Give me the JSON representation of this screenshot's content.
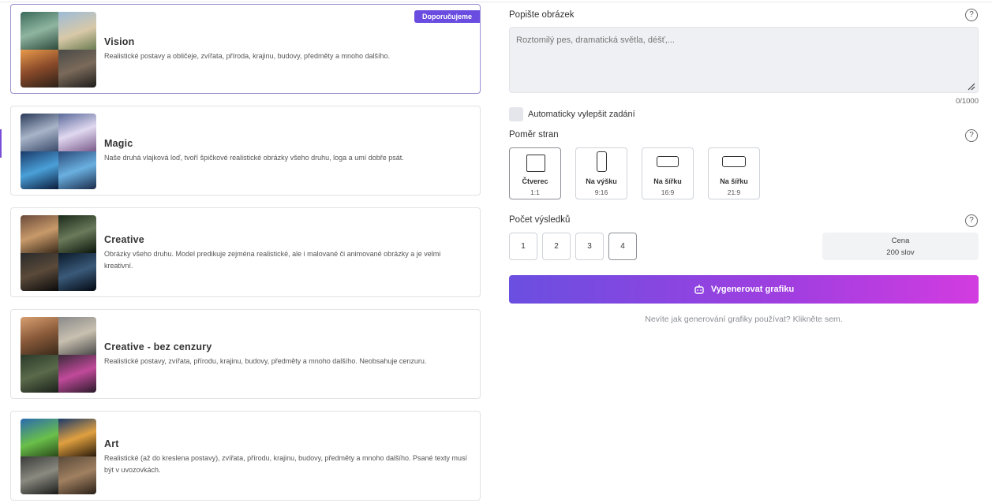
{
  "models": [
    {
      "title": "Vision",
      "description": "Realistické postavy a obličeje, zvířata, příroda, krajinu, budovy, předměty a mnoho dalšího.",
      "badge": "Doporučujeme",
      "selected": true
    },
    {
      "title": "Magic",
      "description": "Naše druhá vlajková loď, tvoří špičkové realistické obrázky všeho druhu, loga a umí dobře psát."
    },
    {
      "title": "Creative",
      "description": "Obrázky všeho druhu. Model predikuje zejména realistické, ale i malované či animované obrázky a je velmi kreativní."
    },
    {
      "title": "Creative - bez cenzury",
      "description": "Realistické postavy, zvířata, přírodu, krajinu, budovy, předměty a mnoho dalšího. Neobsahuje cenzuru."
    },
    {
      "title": "Art",
      "description": "Realistické (až do kreslena postavy), zvířata, přírodu, krajinu, budovy, předměty a mnoho dalšího. Psané texty musí být v uvozovkách."
    }
  ],
  "prompt": {
    "label": "Popište obrázek",
    "placeholder": "Roztomilý pes, dramatická světla, déšť,...",
    "counter": "0/1000"
  },
  "auto_improve": {
    "label": "Automaticky vylepšit zadání",
    "checked": false
  },
  "aspect": {
    "label": "Poměr stran",
    "options": [
      {
        "name": "Čtverec",
        "ratio": "1:1",
        "selected": true
      },
      {
        "name": "Na výšku",
        "ratio": "9:16"
      },
      {
        "name": "Na šířku",
        "ratio": "16:9"
      },
      {
        "name": "Na šířku",
        "ratio": "21:9"
      }
    ]
  },
  "results": {
    "label": "Počet výsledků",
    "options": [
      "1",
      "2",
      "3",
      "4"
    ],
    "selected": "4"
  },
  "price": {
    "label": "Cena",
    "value": "200 slov"
  },
  "generate_label": "Vygenerovat grafiku",
  "help_link": "Nevíte jak generování grafiky používat? Klikněte sem.",
  "help_icon_glyph": "?",
  "colors": {
    "accent": "#6a4ce0",
    "gradient_end": "#d23ce0"
  }
}
